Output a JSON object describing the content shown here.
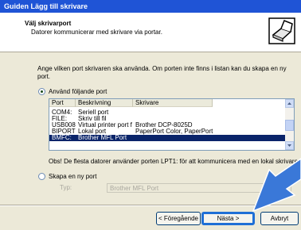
{
  "window": {
    "title": "Guiden Lägg till skrivare"
  },
  "header": {
    "title": "Välj skrivarport",
    "subtitle": "Datorer kommunicerar med skrivare via portar."
  },
  "description": "Ange vilken port skrivaren ska använda. Om porten inte finns i listan kan du skapa en ny port.",
  "use_port": {
    "label": "Använd följande port",
    "selected": true
  },
  "port_list": {
    "columns": [
      "Port",
      "Beskrivning",
      "Skrivare"
    ],
    "rows": [
      {
        "port": "COM4:",
        "description": "Seriell port",
        "printer": ""
      },
      {
        "port": "FILE:",
        "description": "Skriv till fil",
        "printer": ""
      },
      {
        "port": "USB008",
        "description": "Virtual printer port for ...",
        "printer": "Brother DCP-8025D"
      },
      {
        "port": "BIPORT",
        "description": "Lokal port",
        "printer": "PaperPort Color, PaperPort"
      },
      {
        "port": "BMFC:",
        "description": "Brother MFL Port",
        "printer": ""
      }
    ],
    "selected_index": 4
  },
  "note": "Obs! De flesta datorer använder porten LPT1: för att kommunicera med en lokal skrivare.",
  "create_port": {
    "label": "Skapa en ny port",
    "selected": false,
    "type_label": "Typ:",
    "type_value": "Brother MFL Port"
  },
  "buttons": {
    "back": "< Föregående",
    "next": "Nästa >",
    "cancel": "Avbryt"
  },
  "colors": {
    "titlebar": "#1f54d6",
    "selection": "#0a246a",
    "highlight_ring": "#1f6fd6",
    "arrow": "#3a78d8"
  },
  "icons": {
    "wizard": "printer-wizard-icon",
    "pointer": "pointer-arrow-icon"
  }
}
